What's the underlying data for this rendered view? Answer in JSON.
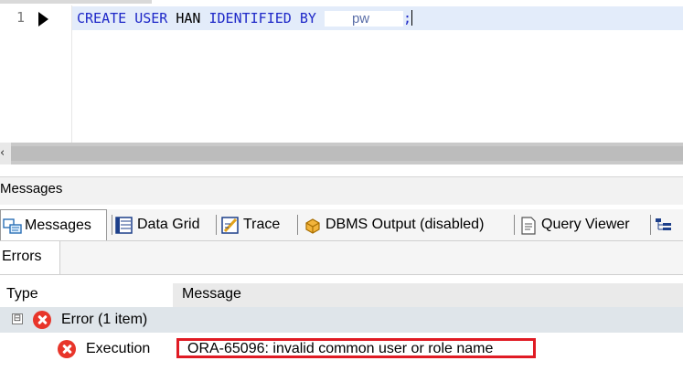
{
  "editor": {
    "line_number": "1",
    "code": {
      "kw_create": "CREATE",
      "kw_user": "USER",
      "username": "HAN",
      "kw_identified": "IDENTIFIED",
      "kw_by": "BY",
      "password": "pw",
      "terminator": ";"
    }
  },
  "scrollbar": {
    "left_arrow": "‹"
  },
  "messages_panel": {
    "title": "Messages",
    "tabs": [
      {
        "label": "Messages",
        "icon": "messages-icon"
      },
      {
        "label": "Data Grid",
        "icon": "data-grid-icon"
      },
      {
        "label": "Trace",
        "icon": "trace-icon"
      },
      {
        "label": "DBMS Output (disabled)",
        "icon": "dbms-output-icon"
      },
      {
        "label": "Query Viewer",
        "icon": "query-viewer-icon"
      }
    ],
    "subtabs": {
      "errors": "Errors"
    },
    "columns": {
      "type": "Type",
      "message": "Message"
    },
    "group": {
      "expander": "⊟",
      "label": "Error (1 item)"
    },
    "rows": [
      {
        "type": "Execution",
        "message": "ORA-65096: invalid common user or role name"
      }
    ]
  },
  "colors": {
    "keyword": "#1e28c8",
    "line_highlight": "#e3ecfa",
    "error_icon": "#e8352a",
    "highlight_box": "#e01b24",
    "group_row_bg": "#dfe5ea"
  }
}
